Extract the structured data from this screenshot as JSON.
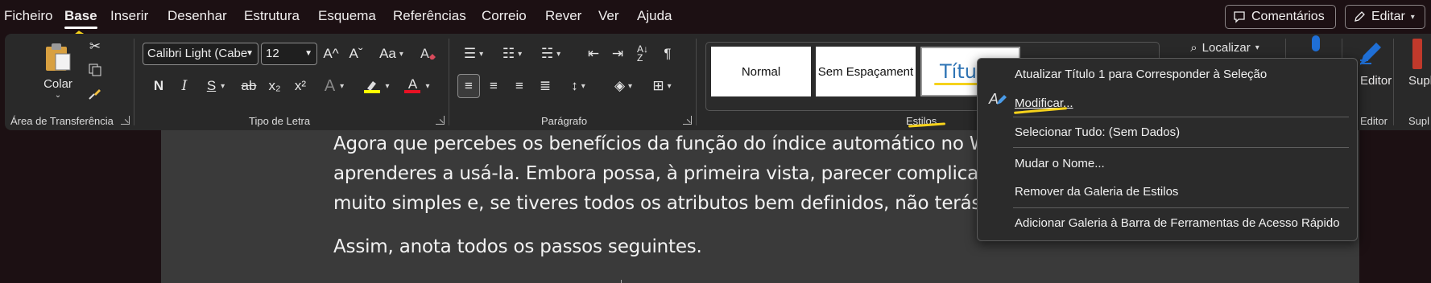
{
  "menubar": {
    "items": [
      "Ficheiro",
      "Base",
      "Inserir",
      "Desenhar",
      "Estrutura",
      "Esquema",
      "Referências",
      "Correio",
      "Rever",
      "Ver",
      "Ajuda"
    ],
    "active": "Base",
    "comments_label": "Comentários",
    "edit_label": "Editar"
  },
  "ribbon": {
    "clipboard": {
      "paste_label": "Colar",
      "group_label": "Área de Transferência"
    },
    "font": {
      "font_name": "Calibri Light (Cabe",
      "font_size": "12",
      "group_label": "Tipo de Letra",
      "grow_label": "A^",
      "shrink_label": "Aˇ",
      "case_label": "Aa",
      "bold": "N",
      "italic": "I",
      "underline": "S",
      "strike": "ab",
      "subscript": "x₂",
      "superscript": "x²",
      "effects": "A",
      "highlight": "ab",
      "font_color": "A"
    },
    "paragraph": {
      "group_label": "Parágrafo"
    },
    "styles": {
      "group_label": "Estilos",
      "tiles": [
        "Normal",
        "Sem Espaçament",
        "Títu"
      ]
    },
    "editing": {
      "find_label": "Localizar",
      "editor_label": "Editor",
      "editor_group_label": "Editor",
      "supl_label": "Supl",
      "supl_group_label": "Supl"
    }
  },
  "document": {
    "lines": [
      "Agora que percebes os benefícios da função do índice automático no W",
      "aprenderes a usá-la. Embora possa, à primeira vista, parecer complicado",
      "muito simples e, se tiveres todos os atributos bem definidos, não terás d",
      "Assim, anota todos os passos seguintes."
    ]
  },
  "context_menu": {
    "items": [
      "Atualizar Título 1 para Corresponder à Seleção",
      "Modificar...",
      "Selecionar Tudo: (Sem Dados)",
      "Mudar o Nome...",
      "Remover da Galeria de Estilos",
      "Adicionar Galeria à Barra de Ferramentas de Acesso Rápido"
    ]
  },
  "colors": {
    "background": "#1c1013",
    "ribbon": "#292929",
    "page": "#3a3a3a",
    "annotation_yellow": "#f6d21b",
    "font_color_red": "#e81123",
    "highlight_yellow": "#ffff00",
    "accent_blue": "#1f6fd6"
  }
}
